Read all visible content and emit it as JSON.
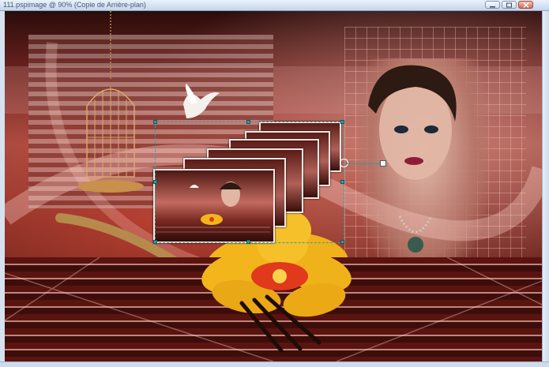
{
  "window": {
    "title": "111.pspimage @ 90% (Copie de Arrière-plan)"
  },
  "colors": {
    "selection_outline": "#2aa0a8",
    "title_bar": "#c5d6ec",
    "canvas_primary": "#a34a40",
    "flower_yellow": "#f2b61c",
    "flower_red": "#e0391c"
  },
  "icons": {
    "minimize": "minimize-icon",
    "maximize": "maximize-icon",
    "close": "close-icon",
    "dove": "dove-icon",
    "birdcage": "birdcage-icon",
    "flower": "flower-icon",
    "fork": "fork-icon"
  }
}
